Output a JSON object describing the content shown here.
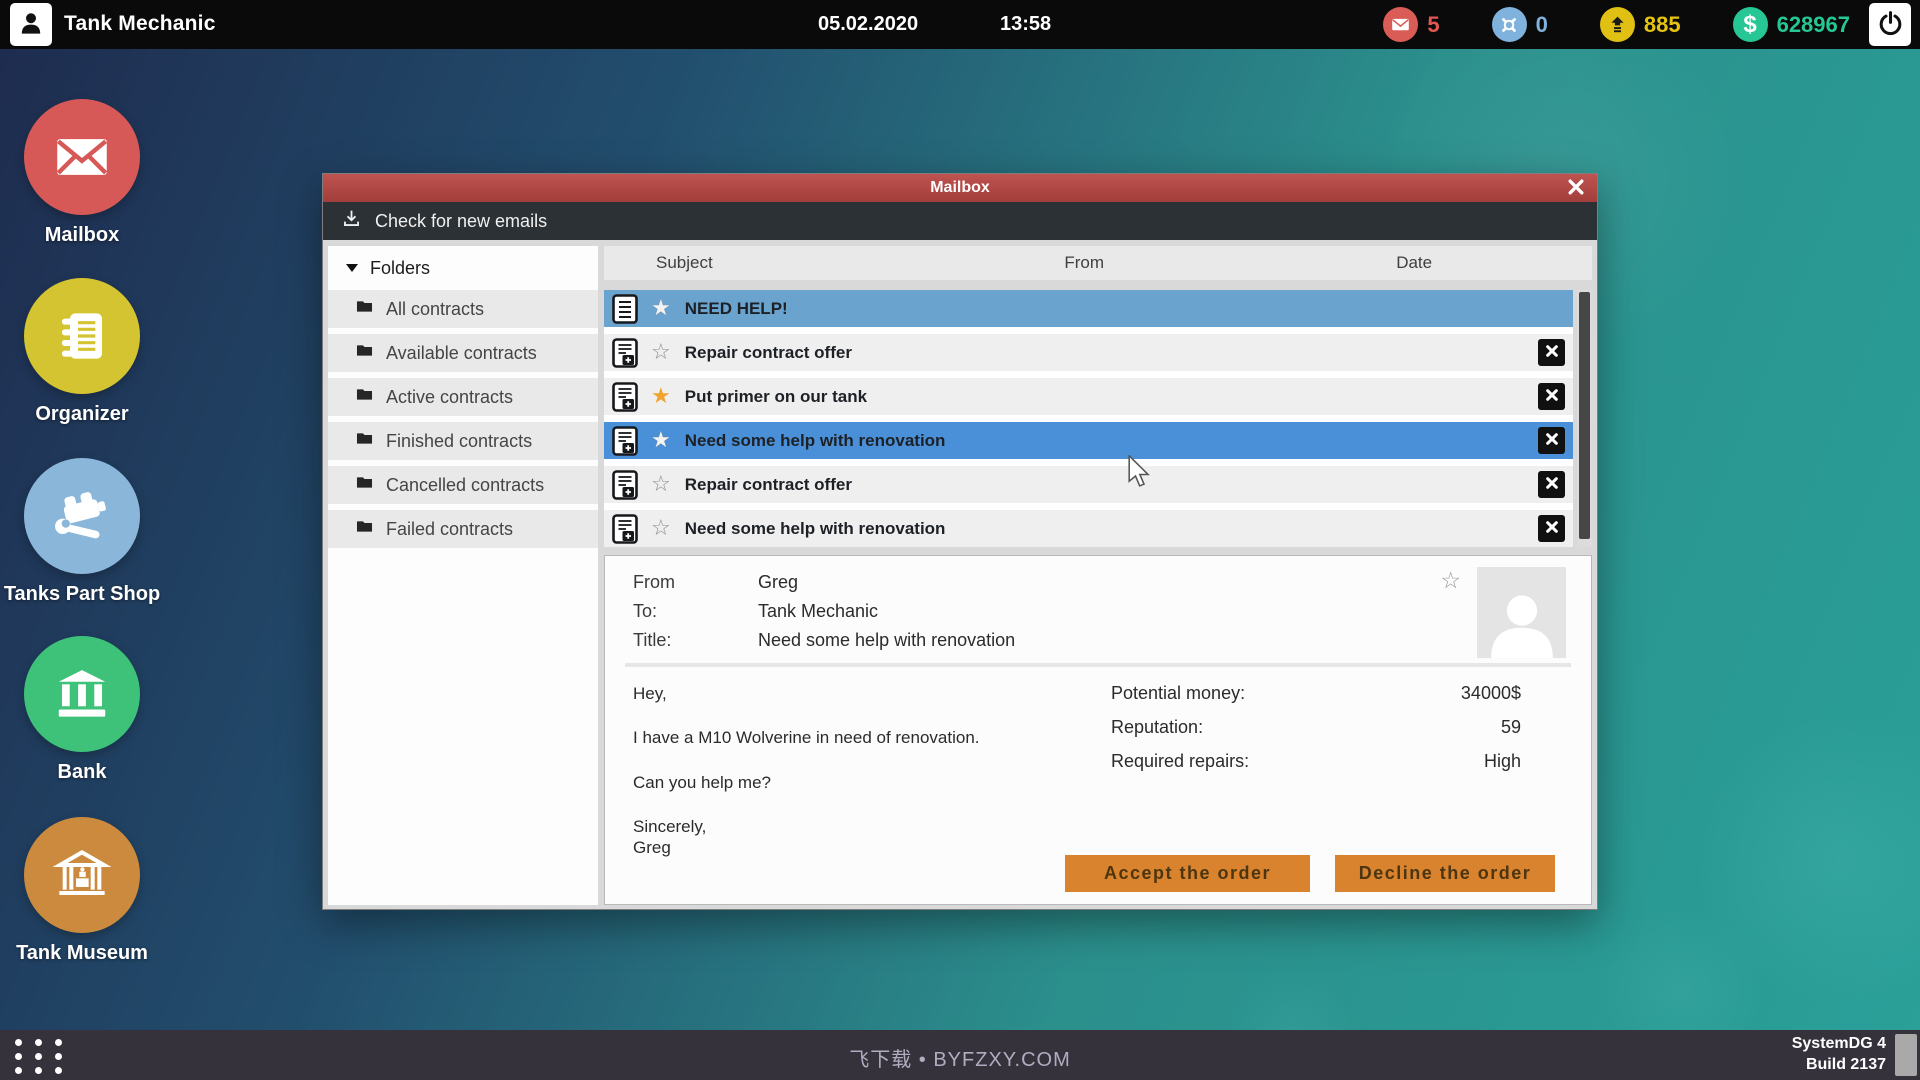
{
  "topbar": {
    "title": "Tank Mechanic",
    "date": "05.02.2020",
    "time": "13:58",
    "mail_count": "5",
    "repairs_count": "0",
    "reputation": "885",
    "money": "628967"
  },
  "desktop_icons": [
    {
      "label": "Mailbox",
      "icon": "envelope-icon",
      "color": "#d65957"
    },
    {
      "label": "Organizer",
      "icon": "organizer-icon",
      "color": "#d4c431"
    },
    {
      "label": "Tanks Part Shop",
      "icon": "parts-shop-icon",
      "color": "#8ab6d9"
    },
    {
      "label": "Bank",
      "icon": "bank-icon",
      "color": "#3ec178"
    },
    {
      "label": "Tank Museum",
      "icon": "museum-icon",
      "color": "#cb8a3e"
    }
  ],
  "window": {
    "title": "Mailbox",
    "toolbar": {
      "check_label": "Check for new emails"
    },
    "folders": {
      "header": "Folders",
      "items": [
        "All contracts",
        "Available contracts",
        "Active contracts",
        "Finished contracts",
        "Cancelled contracts",
        "Failed contracts"
      ]
    },
    "list": {
      "columns": [
        "Subject",
        "From",
        "Date"
      ],
      "rows": [
        {
          "subject": "NEED HELP!",
          "selected": "muted",
          "star": "white",
          "icon": "note",
          "deletable": false
        },
        {
          "subject": "Repair contract offer",
          "selected": "",
          "star": "outline",
          "icon": "contract-add",
          "deletable": true
        },
        {
          "subject": "Put primer on our tank",
          "selected": "",
          "star": "orange",
          "icon": "contract-add",
          "deletable": true
        },
        {
          "subject": "Need some help with renovation",
          "selected": "active",
          "star": "white",
          "icon": "contract-add",
          "deletable": true
        },
        {
          "subject": "Repair contract offer",
          "selected": "",
          "star": "outline",
          "icon": "contract-add",
          "deletable": true
        },
        {
          "subject": "Need some help with renovation",
          "selected": "",
          "star": "outline",
          "icon": "contract-add",
          "deletable": true
        }
      ]
    },
    "detail": {
      "from_label": "From",
      "from": "Greg",
      "to_label": "To:",
      "to": "Tank Mechanic",
      "title_label": "Title:",
      "title": "Need some help with renovation",
      "body": [
        "Hey,",
        "I have a M10 Wolverine in need of renovation.",
        "Can you help me?",
        "Sincerely,\nGreg"
      ],
      "stats": [
        {
          "label": "Potential money:",
          "value": "34000$"
        },
        {
          "label": "Reputation:",
          "value": "59"
        },
        {
          "label": "Required repairs:",
          "value": "High"
        }
      ],
      "accept_label": "Accept the order",
      "decline_label": "Decline the order"
    }
  },
  "taskbar": {
    "watermark": "飞下载 • BYFZXY.COM",
    "system_name": "SystemDG 4",
    "build": "Build 2137"
  },
  "colors": {
    "titlebar_red": "#b54946",
    "selected_row_active": "#4a90d8",
    "selected_row_muted": "#6ba3cf",
    "button_orange": "#d9832e",
    "star_orange": "#f0a32d",
    "mail_badge_red": "#d95c57",
    "repairs_badge_blue": "#7fb2dc",
    "reputation_yellow": "#e0c012",
    "money_green": "#27c795"
  }
}
